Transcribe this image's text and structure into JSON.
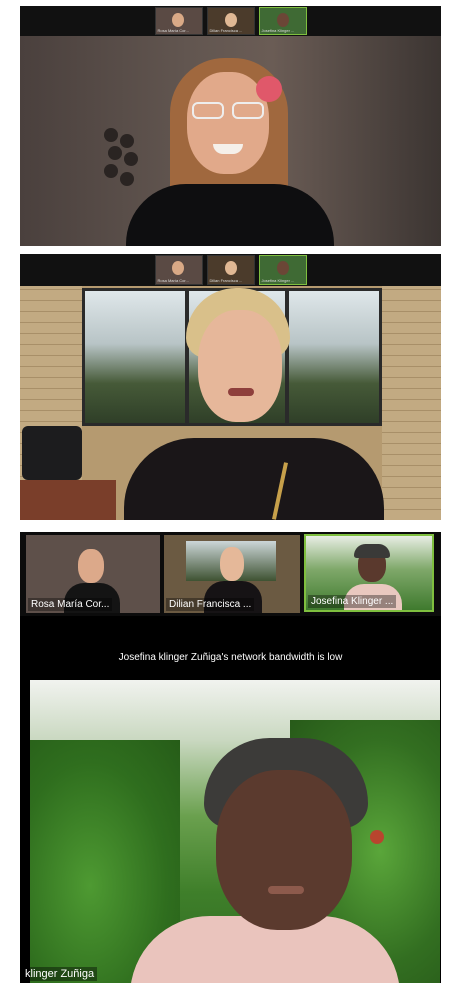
{
  "participants": {
    "rosa": "Rosa María Cor...",
    "dilian": "Dilian Francisca ...",
    "josefina": "Josefina Klinger ..."
  },
  "panel1": {
    "thumb_names": [
      "Rosa María Cor...",
      "Dilian Francisca ...",
      "Josefina Klinger ..."
    ]
  },
  "panel2": {
    "thumb_names": [
      "Rosa María Cor...",
      "Dilian Francisca ...",
      "Josefina Klinger ..."
    ]
  },
  "panel3": {
    "bandwidth_notice": "Josefina klinger Zuñiga's network bandwidth is low",
    "main_speaker_label": "klinger Zuñiga"
  },
  "colors": {
    "active_border": "#7fbf3f",
    "strip_bg": "#111111"
  }
}
